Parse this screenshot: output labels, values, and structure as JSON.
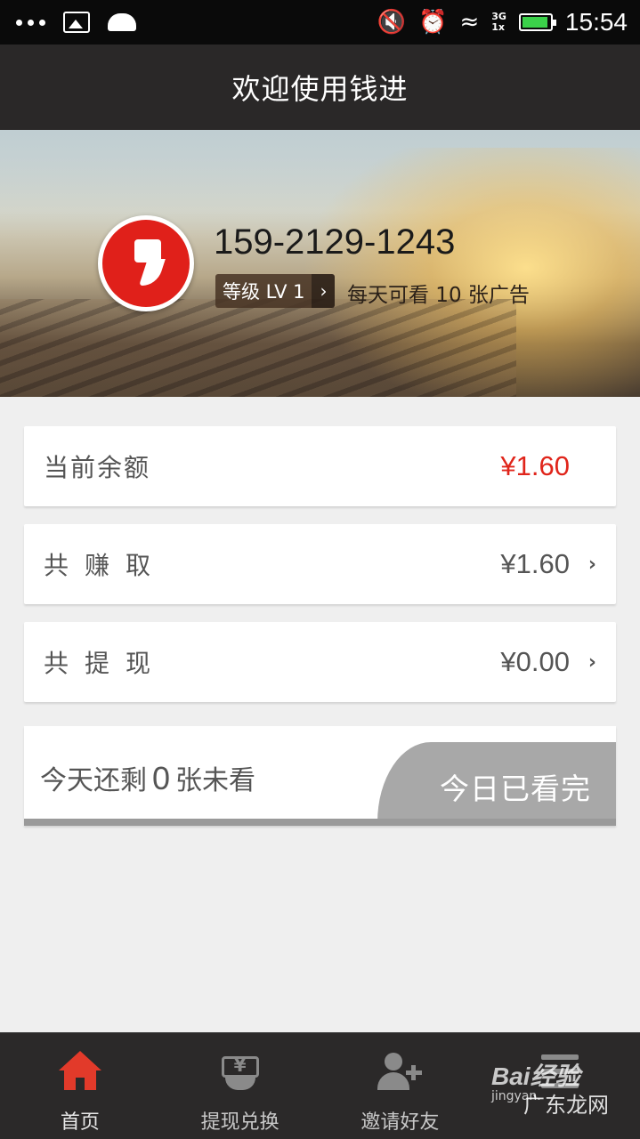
{
  "status_bar": {
    "network": "3G",
    "network2": "1x",
    "time": "15:54"
  },
  "header": {
    "title": "欢迎使用钱进"
  },
  "profile": {
    "phone": "159-2129-1243",
    "level_label": "等级 LV 1",
    "ads_note": "每天可看 10 张广告"
  },
  "account": {
    "balance_label": "当前余额",
    "balance_value": "¥1.60",
    "earned_label": "共赚取",
    "earned_value": "¥1.60",
    "withdrawn_label": "共提现",
    "withdrawn_value": "¥0.00"
  },
  "daily": {
    "prefix": "今天还剩",
    "remaining": "0",
    "suffix": "张未看",
    "button_label": "今日已看完"
  },
  "bottom_nav": [
    {
      "label": "首页",
      "icon": "home-icon",
      "active": true
    },
    {
      "label": "提现兑换",
      "icon": "cash-exchange-icon",
      "active": false
    },
    {
      "label": "邀请好友",
      "icon": "add-user-icon",
      "active": false
    },
    {
      "label": "",
      "icon": "menu-icon",
      "active": false
    }
  ],
  "watermark": {
    "brand": "Bai",
    "brand2": "经验",
    "url": "jingyan.",
    "site": "广东龙网"
  },
  "colors": {
    "accent_red": "#e0251b",
    "header_bg": "#2a2828",
    "nav_bg": "#2b2929",
    "battery": "#3bd14a"
  }
}
